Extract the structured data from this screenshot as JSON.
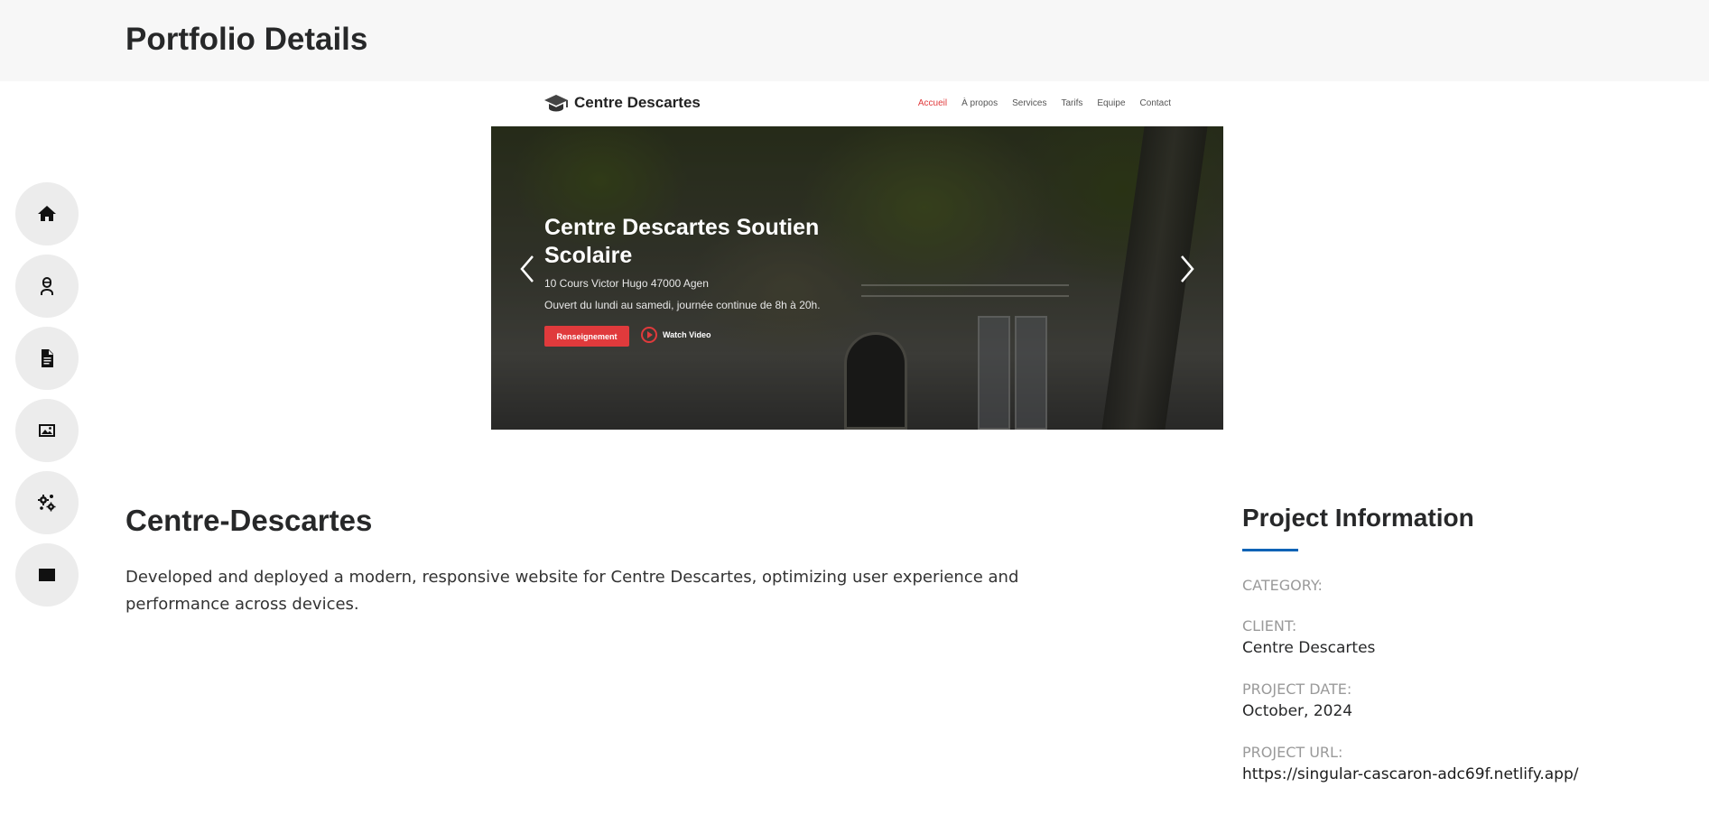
{
  "header": {
    "title": "Portfolio Details"
  },
  "side_nav": {
    "items": [
      {
        "name": "home",
        "icon": "home-icon"
      },
      {
        "name": "about",
        "icon": "person-icon"
      },
      {
        "name": "resume",
        "icon": "document-icon"
      },
      {
        "name": "portfolio",
        "icon": "image-icon"
      },
      {
        "name": "services",
        "icon": "gears-icon"
      },
      {
        "name": "contact",
        "icon": "envelope-icon"
      }
    ]
  },
  "screenshot": {
    "logo_text": "Centre Descartes",
    "menu": [
      "Accueil",
      "À propos",
      "Services",
      "Tarifs",
      "Equipe",
      "Contact"
    ],
    "active_menu": "Accueil",
    "hero_title": "Centre Descartes Soutien Scolaire",
    "hero_address": "10 Cours Victor Hugo 47000 Agen",
    "hero_hours": "Ouvert du lundi au samedi, journée continue de 8h à 20h.",
    "cta_label": "Renseignement",
    "video_label": "Watch Video",
    "accent_color": "#e03a3c"
  },
  "project": {
    "title": "Centre-Descartes",
    "description": "Developed and deployed a modern, responsive website for Centre Descartes, optimizing user experience and performance across devices."
  },
  "info": {
    "heading": "Project Information",
    "accent_color": "#0b63b6",
    "category_label": "CATEGORY:",
    "category_value": "",
    "client_label": "CLIENT:",
    "client_value": "Centre Descartes",
    "date_label": "PROJECT DATE:",
    "date_value": "October, 2024",
    "url_label": "PROJECT URL:",
    "url_value": "https://singular-cascaron-adc69f.netlify.app/"
  }
}
